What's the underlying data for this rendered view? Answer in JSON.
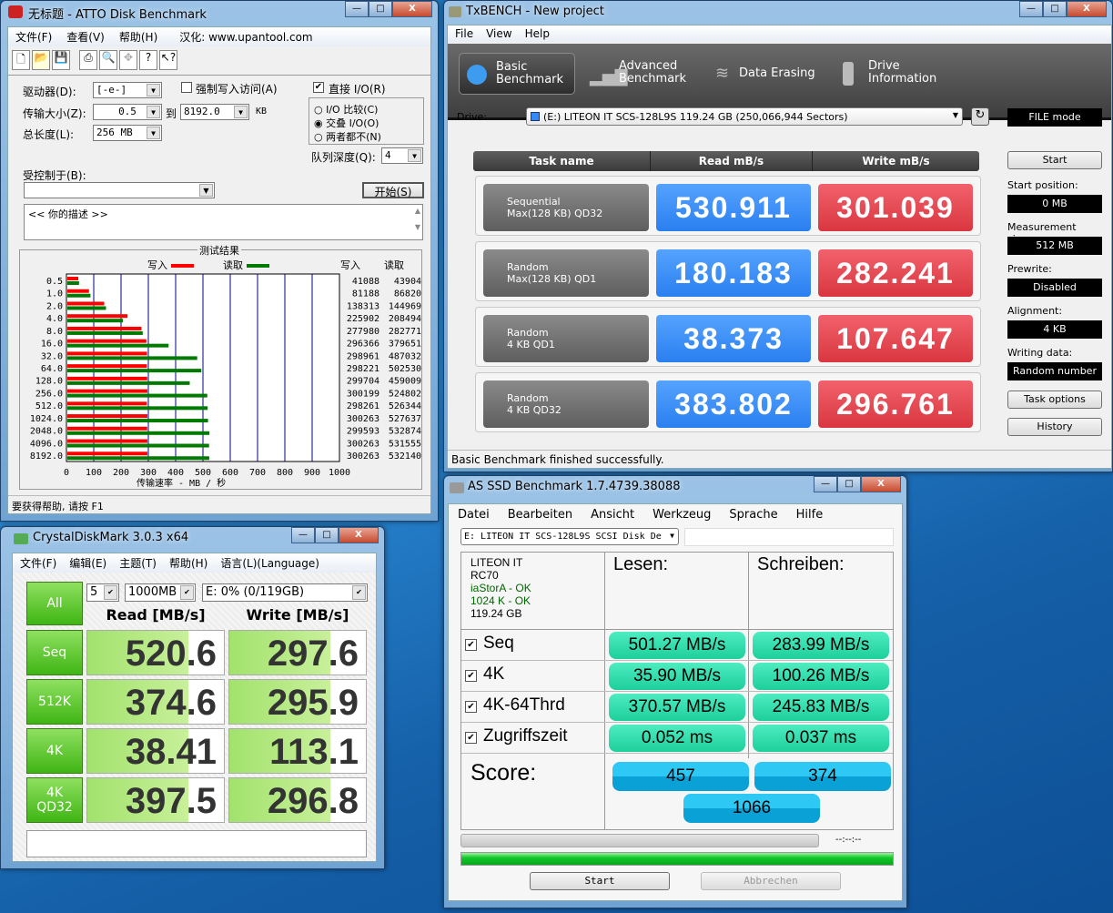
{
  "atto": {
    "title": "无标题 - ATTO Disk Benchmark",
    "menu": [
      "文件(F)",
      "查看(V)",
      "帮助(H)",
      "汉化: www.upantool.com"
    ],
    "toolbar_icons": [
      "new-icon",
      "open-icon",
      "save-icon",
      "print-icon",
      "preview-icon",
      "move-icon",
      "help-icon",
      "context-help-icon"
    ],
    "drive_label": "驱动器(D):",
    "drive_value": "[-e-]",
    "transfer_label": "传输大小(Z):",
    "transfer_from": "0.5",
    "to_label": "到",
    "transfer_to": "8192.0",
    "unit": "KB",
    "length_label": "总长度(L):",
    "length_value": "256 MB",
    "force_write_label": "强制写入访问(A)",
    "force_write_checked": false,
    "direct_io_label": "直接 I/O(R)",
    "direct_io_checked": true,
    "radios": [
      {
        "label": "I/O 比较(C)",
        "checked": false
      },
      {
        "label": "交叠 I/O(O)",
        "checked": true
      },
      {
        "label": "两者都不(N)",
        "checked": false
      }
    ],
    "queue_label": "队列深度(Q):",
    "queue_value": "4",
    "controlled_label": "受控制于(B):",
    "controlled_value": "",
    "start_label": "开始(S)",
    "description": "<<   你的描述    >>",
    "status": "要获得帮助, 请按 F1"
  },
  "chart_data": {
    "type": "bar",
    "title": "测试结果",
    "xlabel": "传输速率 - MB / 秒",
    "xlim": [
      0,
      1000
    ],
    "xticks": [
      "0",
      "100",
      "200",
      "300",
      "400",
      "500",
      "600",
      "700",
      "800",
      "900",
      "1000"
    ],
    "legend": "top",
    "categories": [
      "0.5",
      "1.0",
      "2.0",
      "4.0",
      "8.0",
      "16.0",
      "32.0",
      "64.0",
      "128.0",
      "256.0",
      "512.0",
      "1024.0",
      "2048.0",
      "4096.0",
      "8192.0"
    ],
    "table_headers": [
      "写入",
      "读取"
    ],
    "series": [
      {
        "name": "写入",
        "color": "#ff0000",
        "values": [
          41088,
          81188,
          138313,
          225902,
          277980,
          296366,
          298961,
          298221,
          299704,
          300199,
          298261,
          300263,
          299593,
          300263,
          300263
        ]
      },
      {
        "name": "读取",
        "color": "#007a00",
        "values": [
          43904,
          86820,
          144969,
          208494,
          282771,
          379651,
          487032,
          502530,
          459009,
          524802,
          526344,
          527637,
          532874,
          531555,
          532140
        ]
      }
    ]
  },
  "tx": {
    "title": "TxBENCH - New project",
    "menu": [
      "File",
      "View",
      "Help"
    ],
    "tabs": [
      {
        "l1": "Basic",
        "l2": "Benchmark",
        "icon": "stopwatch-icon"
      },
      {
        "l1": "Advanced",
        "l2": "Benchmark",
        "icon": "bar-chart-icon"
      },
      {
        "l1": "Data Erasing",
        "l2": "",
        "icon": "eraser-icon"
      },
      {
        "l1": "Drive",
        "l2": "Information",
        "icon": "info-icon"
      }
    ],
    "drive_label": "Drive:",
    "drive_value": "(E:) LITEON IT SCS-128L9S  119.24 GB (250,066,944 Sectors)",
    "mode": "FILE mode",
    "headers": [
      "Task name",
      "Read mB/s",
      "Write mB/s"
    ],
    "rows": [
      {
        "l1": "Sequential",
        "l2": "Max(128 KB) QD32",
        "read": "530.911",
        "write": "301.039"
      },
      {
        "l1": "Random",
        "l2": "Max(128 KB) QD1",
        "read": "180.183",
        "write": "282.241"
      },
      {
        "l1": "Random",
        "l2": "4 KB QD1",
        "read": "38.373",
        "write": "107.647"
      },
      {
        "l1": "Random",
        "l2": "4 KB QD32",
        "read": "383.802",
        "write": "296.761"
      }
    ],
    "start": "Start",
    "settings": [
      {
        "label": "Start position:",
        "value": "0 MB"
      },
      {
        "label": "Measurement size:",
        "value": "512 MB"
      },
      {
        "label": "Prewrite:",
        "value": "Disabled"
      },
      {
        "label": "Alignment:",
        "value": "4 KB"
      },
      {
        "label": "Writing data:",
        "value": "Random number"
      }
    ],
    "task_options": "Task options",
    "history": "History",
    "status": "Basic Benchmark finished successfully."
  },
  "cdm": {
    "title": "CrystalDiskMark 3.0.3 x64",
    "menu": [
      "文件(F)",
      "编辑(E)",
      "主题(T)",
      "帮助(H)",
      "语言(L)(Language)"
    ],
    "all": "All",
    "count": "5",
    "size": "1000MB",
    "drive": "E: 0% (0/119GB)",
    "read_header": "Read [MB/s]",
    "write_header": "Write [MB/s]",
    "rows": [
      {
        "l1": "Seq",
        "l2": "",
        "read": "520.6",
        "write": "297.6"
      },
      {
        "l1": "512K",
        "l2": "",
        "read": "374.6",
        "write": "295.9"
      },
      {
        "l1": "4K",
        "l2": "",
        "read": "38.41",
        "write": "113.1"
      },
      {
        "l1": "4K",
        "l2": "QD32",
        "read": "397.5",
        "write": "296.8"
      }
    ],
    "comment": ""
  },
  "asssd": {
    "title": "AS SSD Benchmark 1.7.4739.38088",
    "menu": [
      "Datei",
      "Bearbeiten",
      "Ansicht",
      "Werkzeug",
      "Sprache",
      "Hilfe"
    ],
    "drive": "E: LITEON IT SCS-128L9S SCSI Disk De",
    "info": {
      "model": "LITEON IT",
      "fw": "RC70",
      "driver": "iaStorA - OK",
      "align": "1024 K - OK",
      "size": "119.24 GB"
    },
    "read_header": "Lesen:",
    "write_header": "Schreiben:",
    "rows": [
      {
        "name": "Seq",
        "read": "501.27 MB/s",
        "write": "283.99 MB/s"
      },
      {
        "name": "4K",
        "read": "35.90 MB/s",
        "write": "100.26 MB/s"
      },
      {
        "name": "4K-64Thrd",
        "read": "370.57 MB/s",
        "write": "245.83 MB/s"
      },
      {
        "name": "Zugriffszeit",
        "read": "0.052 ms",
        "write": "0.037 ms"
      }
    ],
    "score_label": "Score:",
    "score_read": "457",
    "score_write": "374",
    "score_total": "1066",
    "time": "--:--:--",
    "progress": 1.0,
    "start": "Start",
    "abort": "Abbrechen"
  }
}
